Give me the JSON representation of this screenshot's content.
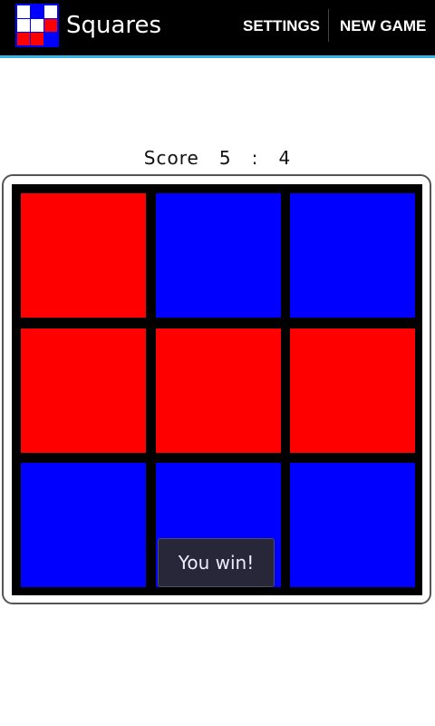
{
  "app": {
    "title": "Squares",
    "icon": "squares-app-icon"
  },
  "action_bar": {
    "settings_label": "SETTINGS",
    "new_game_label": "NEW GAME",
    "accent_color": "#33b5e5"
  },
  "score": {
    "label": "Score",
    "player_one": "5",
    "separator": ":",
    "player_two": "4"
  },
  "board": {
    "size": 3,
    "colors": {
      "red": "#ff0000",
      "blue": "#0000ff",
      "grid": "#000000"
    },
    "cells": [
      [
        "red",
        "blue",
        "blue"
      ],
      [
        "red",
        "red",
        "red"
      ],
      [
        "blue",
        "blue",
        "blue"
      ]
    ]
  },
  "toast": {
    "message": "You win!"
  }
}
